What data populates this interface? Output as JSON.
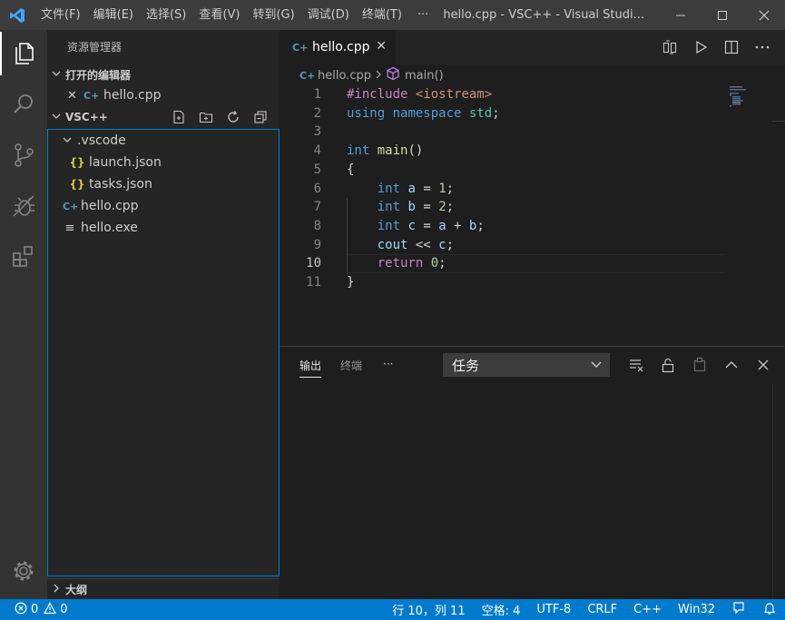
{
  "titlebar": {
    "menu": [
      "文件(F)",
      "编辑(E)",
      "选择(S)",
      "查看(V)",
      "转到(G)",
      "调试(D)",
      "终端(T)"
    ],
    "more": "···",
    "title": "hello.cpp - VSC++ - Visual Studi..."
  },
  "sidebar": {
    "header": "资源管理器",
    "open_editors": {
      "label": "打开的编辑器",
      "items": [
        {
          "close": "✕",
          "name": "hello.cpp"
        }
      ]
    },
    "workspace": {
      "label": "VSC++",
      "folder": ".vscode",
      "files_in_folder": [
        "launch.json",
        "tasks.json"
      ],
      "files": [
        "hello.cpp",
        "hello.exe"
      ]
    },
    "outline_label": "大纲"
  },
  "editor": {
    "tab_label": "hello.cpp",
    "tab_close": "✕",
    "breadcrumb": {
      "file": "hello.cpp",
      "symbol": "main()"
    },
    "line_numbers": [
      "1",
      "2",
      "3",
      "4",
      "5",
      "6",
      "7",
      "8",
      "9",
      "10",
      "11"
    ],
    "code": {
      "l1": {
        "include": "#include",
        "header": "<iostream>"
      },
      "l2": {
        "using": "using",
        "namespace": "namespace",
        "std": "std",
        "semi": ";"
      },
      "l4": {
        "int": "int",
        "main": "main",
        "paren": "()"
      },
      "l5": {
        "brace": "{"
      },
      "l6": {
        "int": "int",
        "var": "a",
        "eq": " = ",
        "num": "1",
        "semi": ";"
      },
      "l7": {
        "int": "int",
        "var": "b",
        "eq": " = ",
        "num": "2",
        "semi": ";"
      },
      "l8": {
        "int": "int",
        "var": "c",
        "eq": " = ",
        "a": "a",
        "plus": " + ",
        "b": "b",
        "semi": ";"
      },
      "l9": {
        "cout": "cout",
        "op": " << ",
        "c": "c",
        "semi": ";"
      },
      "l10": {
        "ret": "return",
        "num": "0",
        "semi": ";"
      },
      "l11": {
        "brace": "}"
      }
    },
    "current_line": 10
  },
  "panel": {
    "tabs": [
      "输出",
      "终端"
    ],
    "more": "···",
    "select_value": "任务"
  },
  "statusbar": {
    "errors": "0",
    "warnings": "0",
    "position": "行 10，列 11",
    "indent": "空格: 4",
    "encoding": "UTF-8",
    "eol": "CRLF",
    "language": "C++",
    "platform": "Win32"
  },
  "colors": {
    "accent": "#007acc",
    "titlebar": "#3c3c3c",
    "activitybar": "#333333",
    "sidebar": "#252526",
    "editor": "#1e1e1e"
  }
}
